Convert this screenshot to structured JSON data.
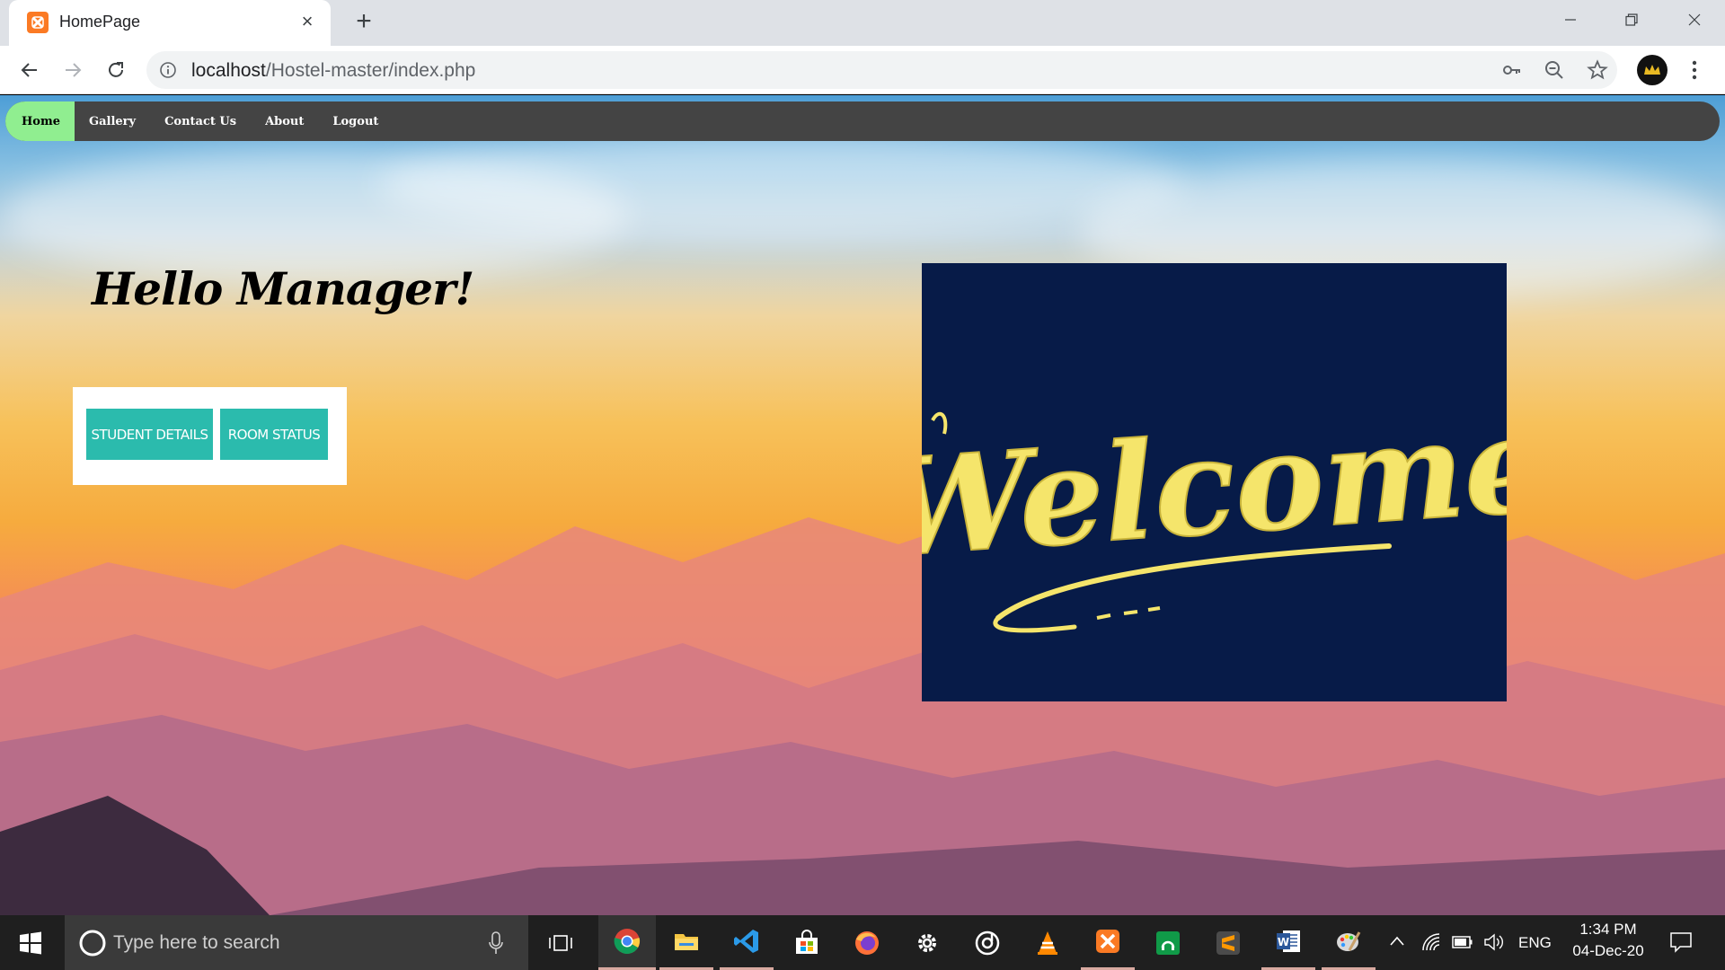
{
  "browser": {
    "tab_title": "HomePage",
    "tab_close": "×",
    "new_tab": "+",
    "url_host": "localhost",
    "url_path": "/Hostel-master/index.php"
  },
  "page": {
    "nav": [
      {
        "label": "Home",
        "active": true
      },
      {
        "label": "Gallery",
        "active": false
      },
      {
        "label": "Contact Us",
        "active": false
      },
      {
        "label": "About",
        "active": false
      },
      {
        "label": "Logout",
        "active": false
      }
    ],
    "greeting": "Hello Manager!",
    "buttons": {
      "student_details": "STUDENT DETAILS",
      "room_status": "ROOM STATUS"
    },
    "welcome_image_text": "Welcome",
    "colors": {
      "nav_bg": "#444444",
      "nav_active": "#90ee90",
      "button_bg": "#2bbbad",
      "welcome_bg": "#071b48",
      "welcome_text": "#f5e56b"
    }
  },
  "taskbar": {
    "search_placeholder": "Type here to search",
    "language": "ENG",
    "time": "1:34 PM",
    "date": "04-Dec-20",
    "apps": [
      "chrome-icon",
      "file-explorer-icon",
      "vscode-icon",
      "store-icon",
      "firefox-icon",
      "settings-icon",
      "groove-icon",
      "vlc-icon",
      "xampp-icon",
      "green-app-icon",
      "sublime-icon",
      "word-icon",
      "paint-icon"
    ]
  }
}
